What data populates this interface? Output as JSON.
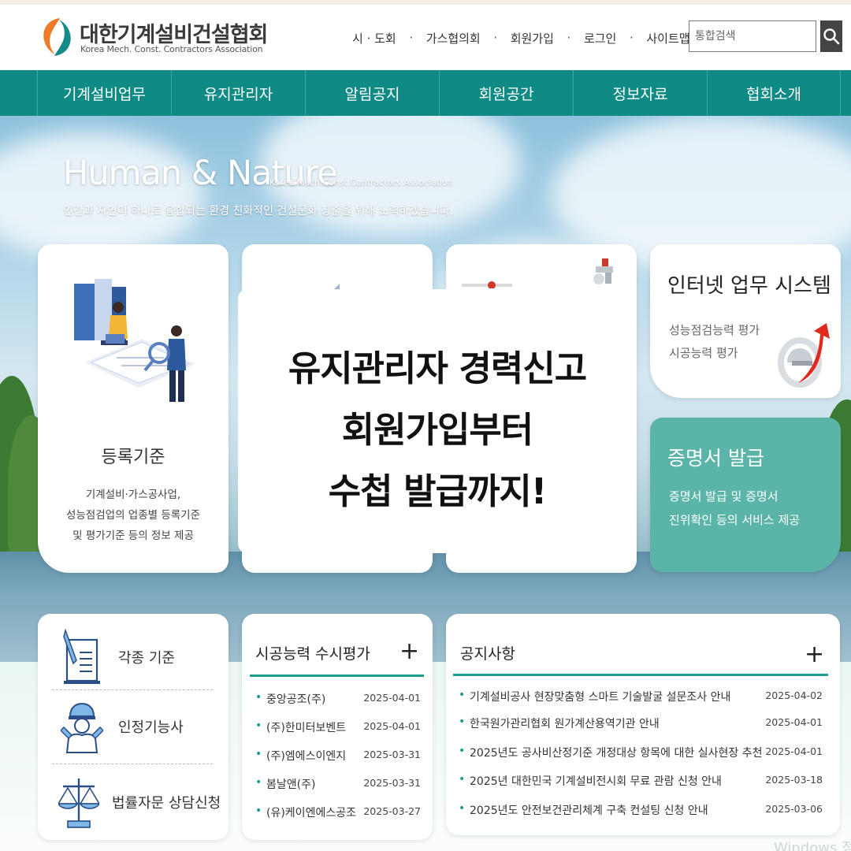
{
  "site": {
    "title": "대한기계설비건설협회",
    "subtitle": "Korea Mech. Const. Contractors Association"
  },
  "util_links": [
    "시 · 도회",
    "가스협의회",
    "회원가입",
    "로그인",
    "사이트맵"
  ],
  "search": {
    "placeholder": "통합검색",
    "icon": "search-icon"
  },
  "nav": [
    "기계설비업무",
    "유지관리자",
    "알림공지",
    "회원공간",
    "정보자료",
    "협회소개"
  ],
  "hero": {
    "title": "Human & Nature",
    "sub": "Korea Mech.Const.Contractors Association",
    "desc": "인간과 자연이 하나로 융합되는 환경 친화적인 건설문화 창출을 위해 노력하겠습니다."
  },
  "card_registration": {
    "title": "등록기준",
    "desc": "기계설비·가스공사업,\n성능점검업의 업종별 등록기준\n및 평가기준 등의 정보 제공"
  },
  "card_internet": {
    "title": "인터넷 업무 시스템",
    "desc": "성능점검능력 평가\n시공능력 평가"
  },
  "card_certificate": {
    "title": "증명서 발급",
    "desc": "증명서 발급 및 증명서\n진위확인 등의 서비스 제공"
  },
  "overlay": {
    "text": "유지관리자 경력신고\n회원가입부터\n수첩 발급까지!"
  },
  "quick_links": [
    {
      "label": "각종 기준",
      "icon": "document-pen-icon"
    },
    {
      "label": "인정기능사",
      "icon": "technician-icon"
    },
    {
      "label": "법률자문 상담신청",
      "icon": "scales-icon"
    }
  ],
  "eval_panel": {
    "title": "시공능력 수시평가",
    "more": "+",
    "items": [
      {
        "name": "중앙공조(주)",
        "date": "2025-04-01"
      },
      {
        "name": "(주)한미터보벤트",
        "date": "2025-04-01"
      },
      {
        "name": "(주)엠에스이엔지",
        "date": "2025-03-31"
      },
      {
        "name": "봄날앤(주)",
        "date": "2025-03-31"
      },
      {
        "name": "(유)케이엔에스공조",
        "date": "2025-03-27"
      }
    ]
  },
  "notice_panel": {
    "title": "공지사항",
    "more": "+",
    "items": [
      {
        "title": "기계설비공사 현장맞춤형 스마트 기술발굴 설문조사 안내",
        "date": "2025-04-02"
      },
      {
        "title": "한국원가관리협회 원가계산용역기관 안내",
        "date": "2025-04-01"
      },
      {
        "title": "2025년도 공사비산정기준 개정대상 항목에 대한 실사현장 추천",
        "date": "2025-04-01"
      },
      {
        "title": "2025년 대한민국 기계설비전시회 무료 관람 신청 안내",
        "date": "2025-03-18"
      },
      {
        "title": "2025년도 안전보건관리체계 구축 컨설팅 신청 안내",
        "date": "2025-03-06"
      }
    ]
  },
  "watermark": "Windows 정",
  "colors": {
    "nav_bg": "#0f8a85",
    "accent_line": "#1c9f8f",
    "cert_card": "#5ab4a7",
    "logo_orange": "#ee7a2a",
    "logo_teal": "#168a86"
  }
}
